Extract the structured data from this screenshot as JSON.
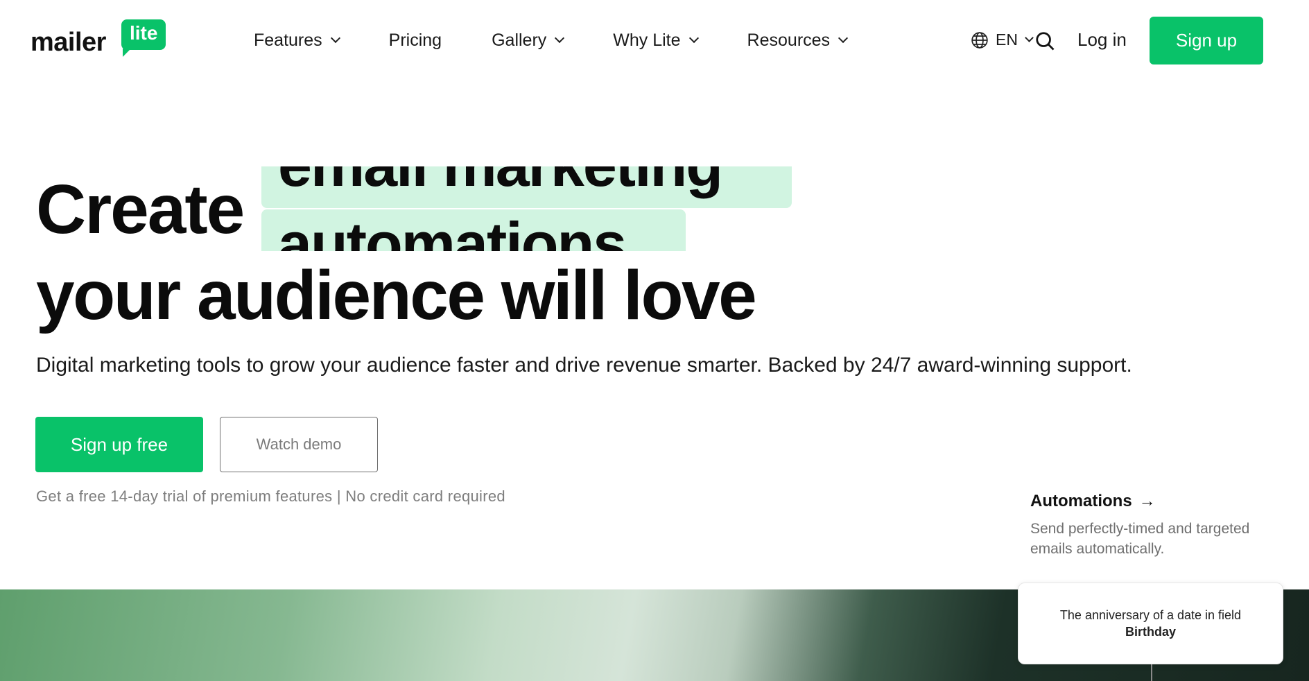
{
  "brand": {
    "wordmark": "mailer",
    "badge": "lite",
    "accent_color": "#09c269",
    "highlight_color": "#d1f4e1"
  },
  "nav": {
    "items": [
      {
        "label": "Features",
        "has_dropdown": true
      },
      {
        "label": "Pricing",
        "has_dropdown": false
      },
      {
        "label": "Gallery",
        "has_dropdown": true
      },
      {
        "label": "Why Lite",
        "has_dropdown": true
      },
      {
        "label": "Resources",
        "has_dropdown": true
      }
    ],
    "language": "EN",
    "login": "Log in",
    "signup": "Sign up"
  },
  "hero": {
    "lead_word": "Create",
    "rotating_words": [
      "email marketing",
      "automations"
    ],
    "tail": "your audience will love",
    "subtitle": "Digital marketing tools to grow your audience faster and drive revenue smarter. Backed by 24/7 award-winning support.",
    "primary_cta": "Sign up free",
    "secondary_cta": "Watch demo",
    "note": "Get a free 14-day trial of premium features | No credit card required"
  },
  "feature": {
    "title": "Automations",
    "arrow": "→",
    "description": "Send perfectly-timed and targeted emails automatically."
  },
  "automation_card": {
    "text": "The anniversary of a date in field",
    "field": "Birthday"
  }
}
